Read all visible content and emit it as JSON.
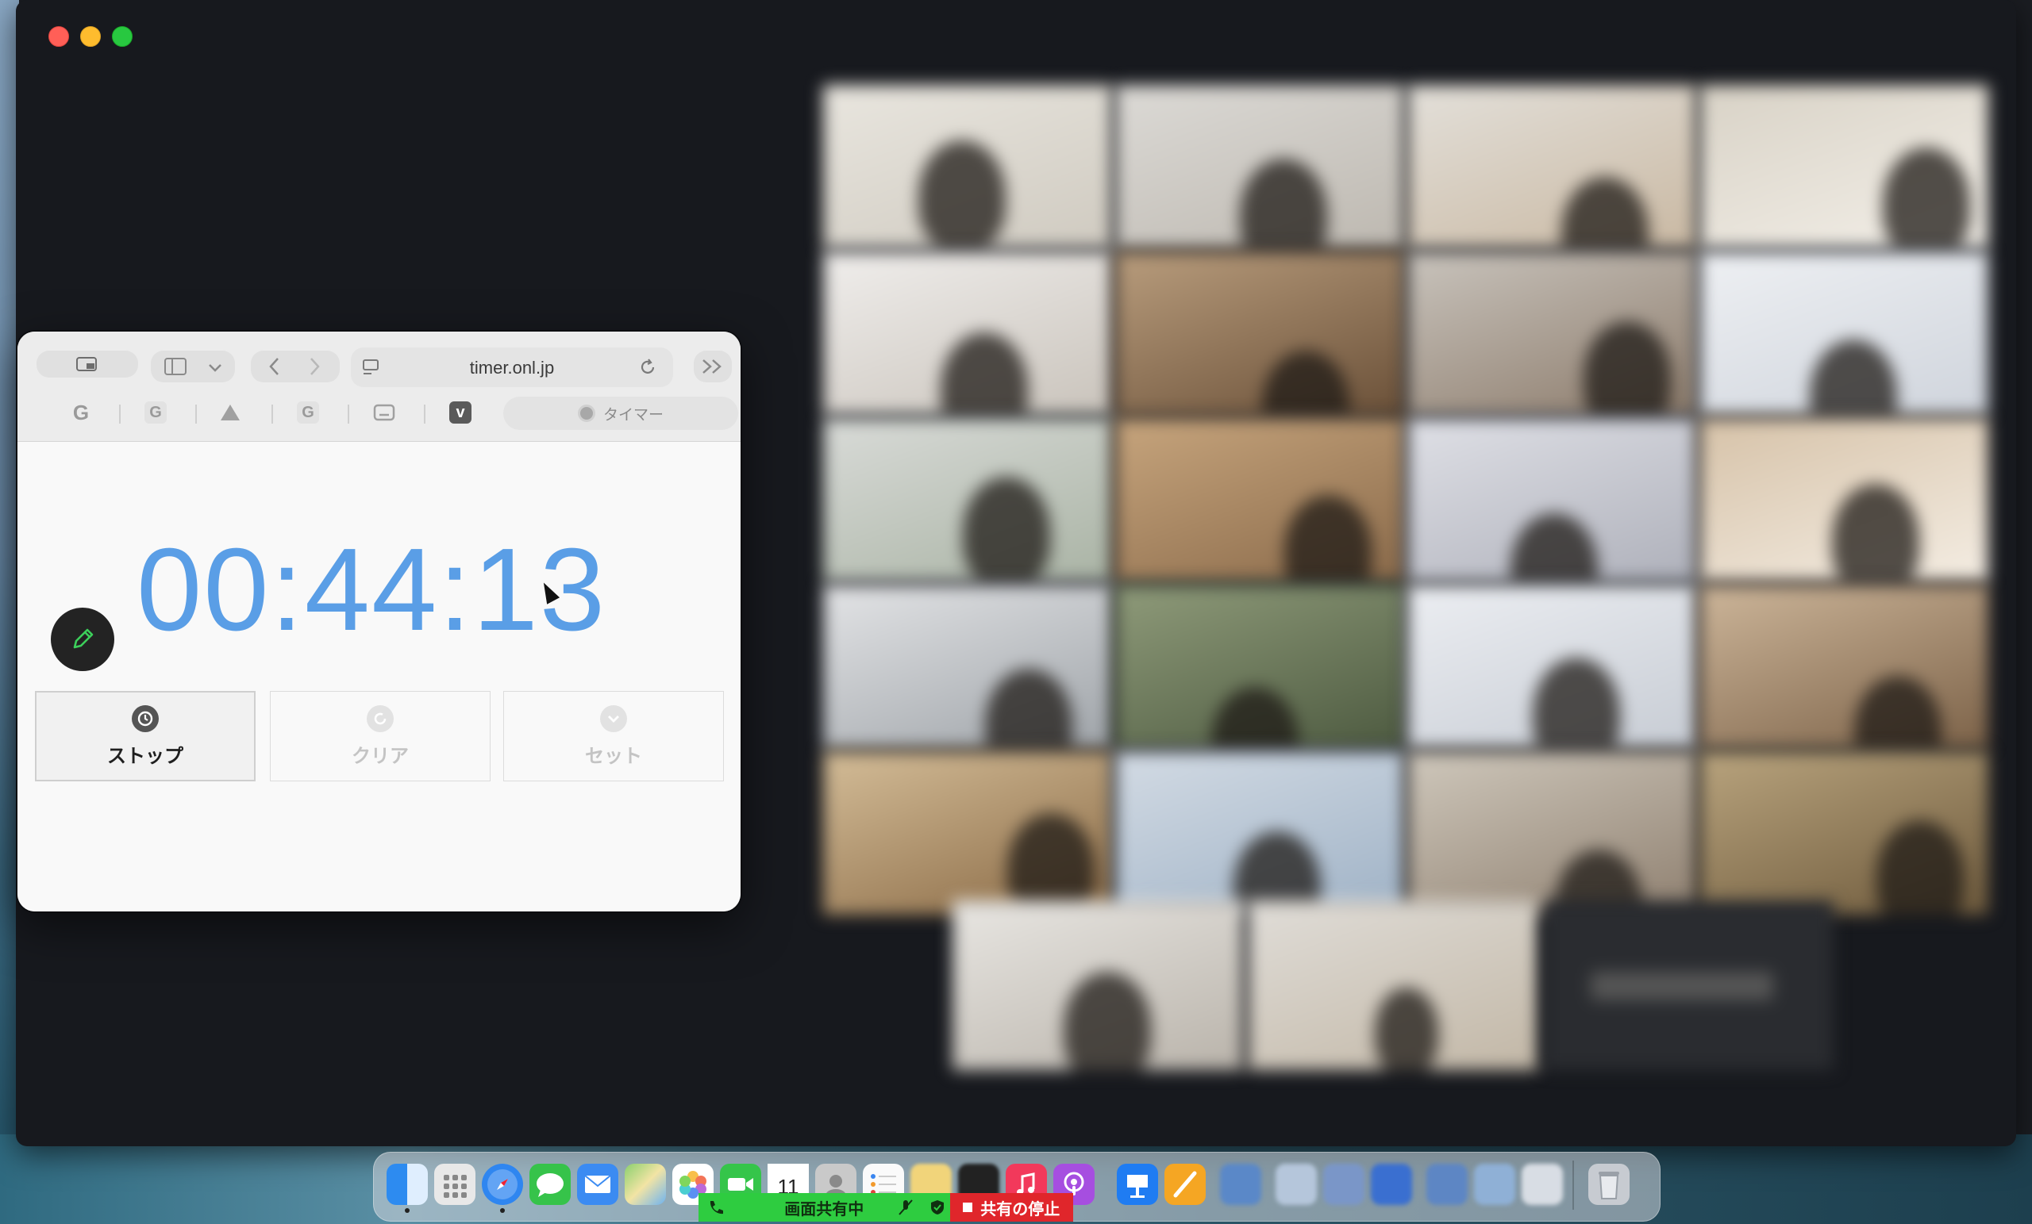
{
  "browser": {
    "url": "timer.onl.jp",
    "tab_title": "タイマー",
    "favorites": [
      "G",
      "G",
      "drive",
      "G",
      "box",
      "v"
    ]
  },
  "timer": {
    "display": "00:44:13",
    "buttons": {
      "stop": "ストップ",
      "clear": "クリア",
      "set": "セット"
    }
  },
  "share_bar": {
    "sharing_label": "画面共有中",
    "stop_label": "共有の停止"
  },
  "dock": {
    "calendar_day": "11"
  },
  "colors": {
    "timer_digits": "#5a9ee6",
    "share_green": "#2ecc40",
    "share_red": "#e0262b"
  }
}
